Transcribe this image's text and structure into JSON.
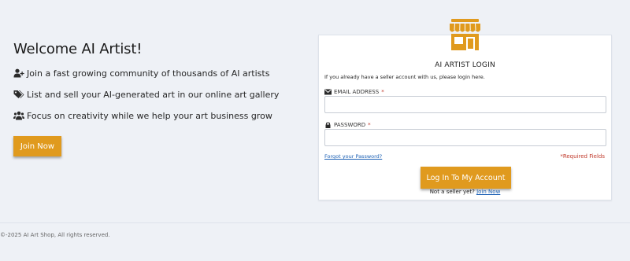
{
  "hero": {
    "title": "Welcome AI Artist!",
    "bullets": [
      {
        "icon": "user-plus-icon",
        "text": "Join a fast growing community of thousands of AI artists"
      },
      {
        "icon": "tags-icon",
        "text": "List and sell your AI-generated art in our online art gallery"
      },
      {
        "icon": "users-icon",
        "text": "Focus on creativity while we help your art business grow"
      }
    ],
    "join_button": "Join Now"
  },
  "login": {
    "icon": "storefront-icon",
    "title": "AI ARTIST LOGIN",
    "subtitle": "If you already have a seller account with us, please login here.",
    "email_label": "EMAIL ADDRESS",
    "email_value": "",
    "password_label": "PASSWORD",
    "password_value": "",
    "required_marker": "*",
    "forgot_link": "Forgot your Password?",
    "required_note": "*Required Fields",
    "submit_button": "Log In To My Account",
    "not_seller_text": "Not a seller yet?",
    "join_link": "Join Now"
  },
  "footer": {
    "copyright": "©-2025 AI Art Shop, All rights reserved."
  },
  "colors": {
    "accent": "#e09a1e",
    "link": "#1a5fb4",
    "required": "#c0392b",
    "background": "#eef1f6"
  }
}
